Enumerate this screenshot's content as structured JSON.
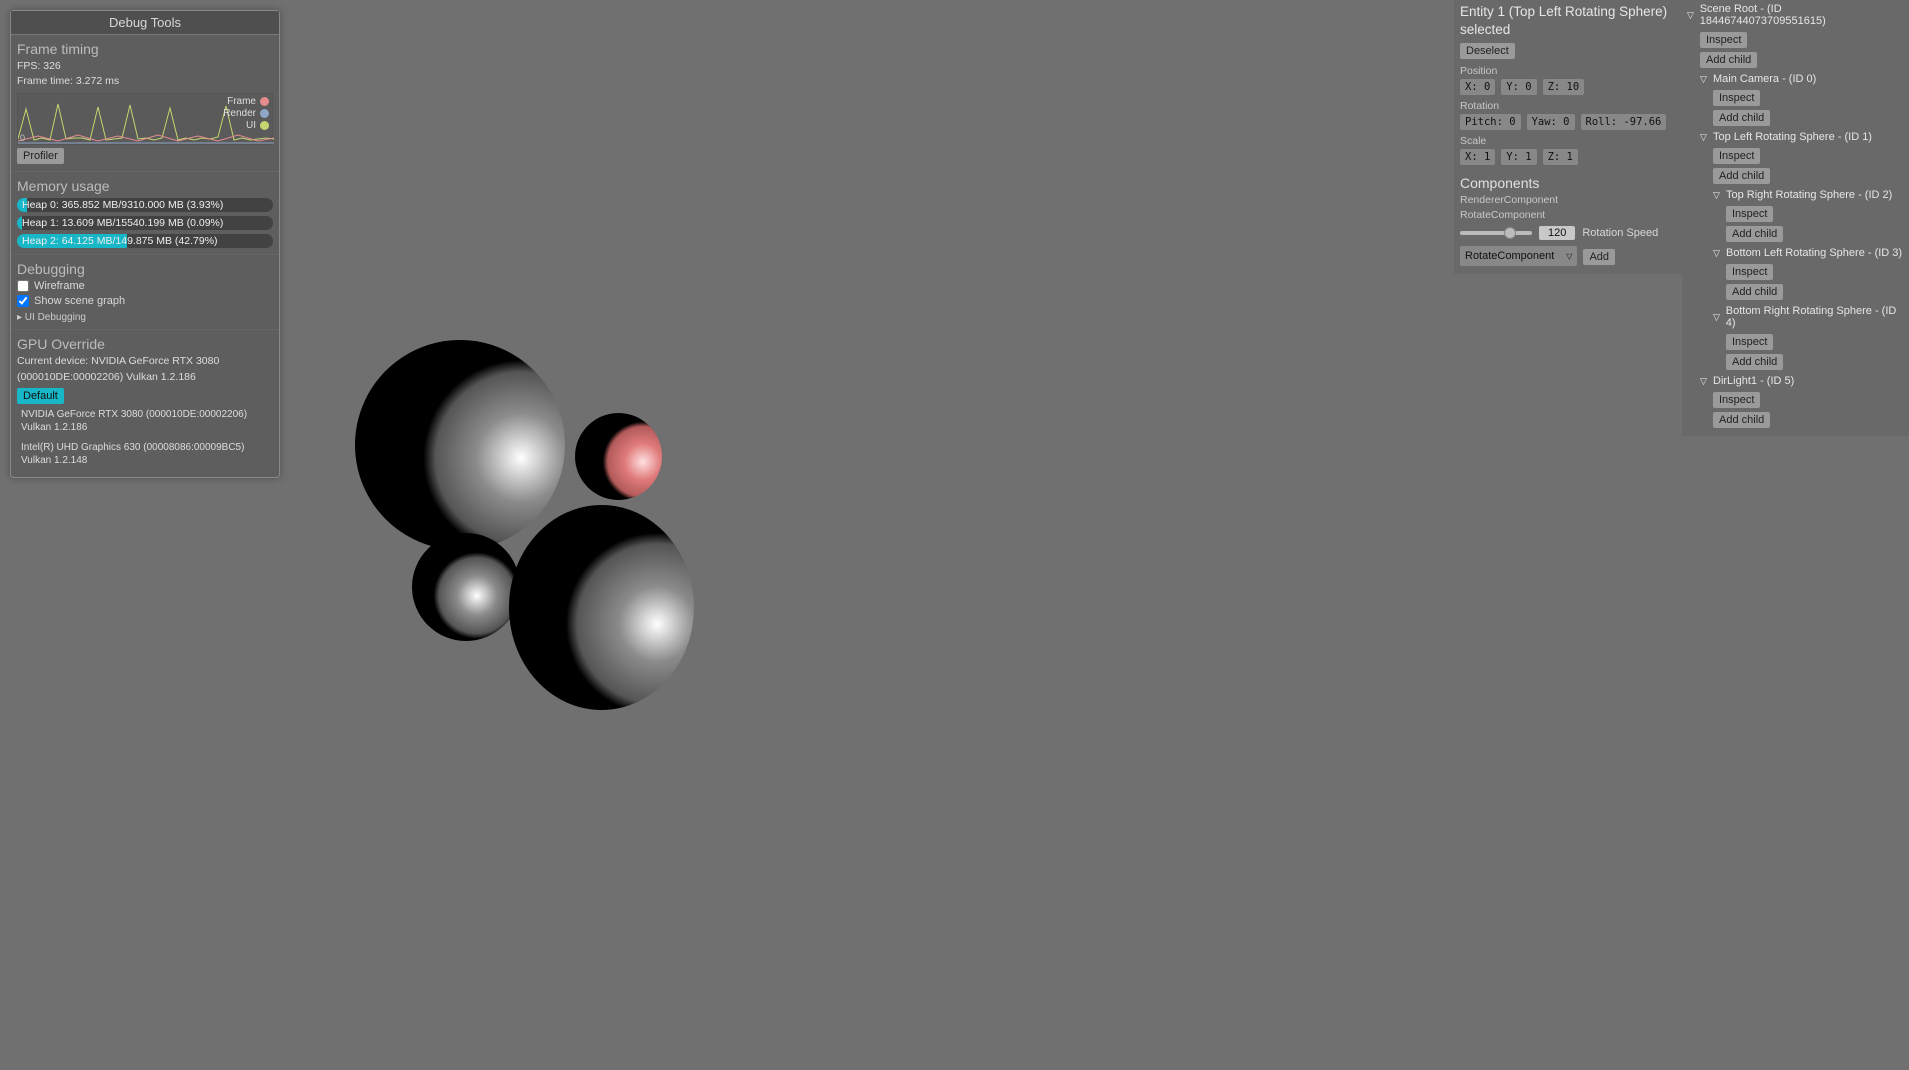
{
  "debug": {
    "title": "Debug Tools",
    "frame_timing": {
      "heading": "Frame timing",
      "fps_label": "FPS: 326",
      "frametime_label": "Frame time: 3.272 ms",
      "legend": {
        "frame": "Frame",
        "render": "Render",
        "ui": "UI"
      },
      "tick0": "0",
      "profiler_btn": "Profiler"
    },
    "memory": {
      "heading": "Memory usage",
      "heaps": [
        {
          "label": "Heap 0: 365.852 MB/9310.000 MB (3.93%)",
          "pct": 3.93
        },
        {
          "label": "Heap 1: 13.609 MB/15540.199 MB (0.09%)",
          "pct": 0.09
        },
        {
          "label": "Heap 2: 64.125 MB/149.875 MB (42.79%)",
          "pct": 42.79
        }
      ]
    },
    "debugging": {
      "heading": "Debugging",
      "wireframe": "Wireframe",
      "showscene": "Show scene graph",
      "uidebug": "▸ UI Debugging"
    },
    "gpu": {
      "heading": "GPU Override",
      "current": "Current device: NVIDIA GeForce RTX 3080 (000010DE:00002206) Vulkan 1.2.186",
      "default_btn": "Default",
      "items": [
        "NVIDIA GeForce RTX 3080 (000010DE:00002206) Vulkan 1.2.186",
        "Intel(R) UHD Graphics 630 (00008086:00009BC5) Vulkan 1.2.148"
      ]
    }
  },
  "inspector": {
    "title": "Entity 1 (Top Left Rotating Sphere) selected",
    "deselect": "Deselect",
    "pos_label": "Position",
    "pos": {
      "x": "X: 0",
      "y": "Y: 0",
      "z": "Z: 10"
    },
    "rot_label": "Rotation",
    "rot": {
      "pitch": "Pitch: 0",
      "yaw": "Yaw: 0",
      "roll": "Roll: -97.66"
    },
    "scale_label": "Scale",
    "scale": {
      "x": "X: 1",
      "y": "Y: 1",
      "z": "Z: 1"
    },
    "components_heading": "Components",
    "comp_renderer": "RendererComponent",
    "comp_rotate": "RotateComponent",
    "rotation_speed_value": "120",
    "rotation_speed_label": "Rotation Speed",
    "add_combo": "RotateComponent",
    "add_btn": "Add"
  },
  "scene": {
    "inspect": "Inspect",
    "addchild": "Add child",
    "root": "Scene Root - (ID 18446744073709551615)",
    "nodes": [
      {
        "label": "Main Camera - (ID 0)",
        "children": []
      },
      {
        "label": "Top Left Rotating Sphere - (ID 1)",
        "children": [
          {
            "label": "Top Right Rotating Sphere - (ID 2)"
          },
          {
            "label": "Bottom Left Rotating Sphere - (ID 3)"
          },
          {
            "label": "Bottom Right Rotating Sphere - (ID 4)"
          }
        ]
      },
      {
        "label": "DirLight1 - (ID 5)",
        "children": []
      }
    ]
  },
  "colors": {
    "frame_dot": "#e48b8e",
    "render_dot": "#8ea7c6",
    "ui_dot": "#c4d66f",
    "accent": "#17b7c7"
  }
}
